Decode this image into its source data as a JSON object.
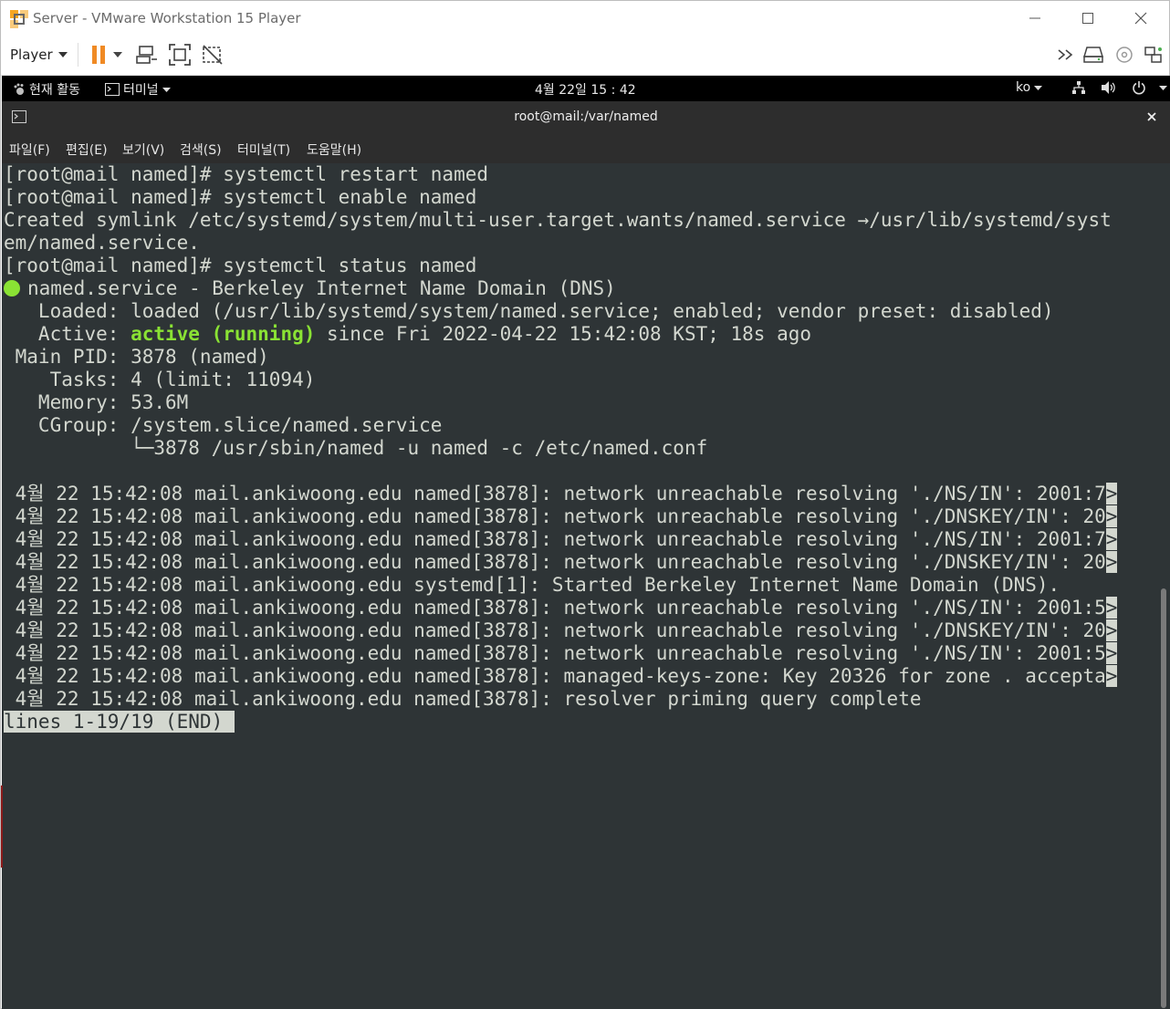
{
  "window": {
    "title": "Server - VMware Workstation 15 Player"
  },
  "toolbar": {
    "player_label": "Player"
  },
  "gnome": {
    "activities": "현재 활동",
    "app_menu": "터미널",
    "clock": "4월 22일  15 : 42",
    "lang": "ko"
  },
  "terminal": {
    "title": "root@mail:/var/named",
    "menu": [
      "파일(F)",
      "편집(E)",
      "보기(V)",
      "검색(S)",
      "터미널(T)",
      "도움말(H)"
    ],
    "lines": [
      "[root@mail named]# systemctl restart named",
      "[root@mail named]# systemctl enable named",
      "Created symlink /etc/systemd/system/multi-user.target.wants/named.service →/usr/lib/systemd/syst",
      "em/named.service.",
      "[root@mail named]# systemctl status named"
    ],
    "status": {
      "unit": "named.service - Berkeley Internet Name Domain (DNS)",
      "loaded": "   Loaded: loaded (/usr/lib/systemd/system/named.service; enabled; vendor preset: disabled)",
      "active_prefix": "   Active: ",
      "active_state": "active (running)",
      "active_suffix": " since Fri 2022-04-22 15:42:08 KST; 18s ago",
      "main_pid": " Main PID: 3878 (named)",
      "tasks": "    Tasks: 4 (limit: 11094)",
      "memory": "   Memory: 53.6M",
      "cgroup": "   CGroup: /system.slice/named.service",
      "cgroup_child": "           └─3878 /usr/sbin/named -u named -c /etc/named.conf"
    },
    "log": [
      {
        "text": " 4월 22 15:42:08 mail.ankiwoong.edu named[3878]: network unreachable resolving './NS/IN': 2001:7",
        "truncated": true
      },
      {
        "text": " 4월 22 15:42:08 mail.ankiwoong.edu named[3878]: network unreachable resolving './DNSKEY/IN': 20",
        "truncated": true
      },
      {
        "text": " 4월 22 15:42:08 mail.ankiwoong.edu named[3878]: network unreachable resolving './NS/IN': 2001:7",
        "truncated": true
      },
      {
        "text": " 4월 22 15:42:08 mail.ankiwoong.edu named[3878]: network unreachable resolving './DNSKEY/IN': 20",
        "truncated": true
      },
      {
        "text": " 4월 22 15:42:08 mail.ankiwoong.edu systemd[1]: Started Berkeley Internet Name Domain (DNS).",
        "truncated": false
      },
      {
        "text": " 4월 22 15:42:08 mail.ankiwoong.edu named[3878]: network unreachable resolving './NS/IN': 2001:5",
        "truncated": true
      },
      {
        "text": " 4월 22 15:42:08 mail.ankiwoong.edu named[3878]: network unreachable resolving './DNSKEY/IN': 20",
        "truncated": true
      },
      {
        "text": " 4월 22 15:42:08 mail.ankiwoong.edu named[3878]: network unreachable resolving './NS/IN': 2001:5",
        "truncated": true
      },
      {
        "text": " 4월 22 15:42:08 mail.ankiwoong.edu named[3878]: managed-keys-zone: Key 20326 for zone . accepta",
        "truncated": true
      },
      {
        "text": " 4월 22 15:42:08 mail.ankiwoong.edu named[3878]: resolver priming query complete",
        "truncated": false
      }
    ],
    "truncation_marker": ">",
    "pager_status": "lines 1-19/19 (END) "
  },
  "colors": {
    "terminal_bg": "#2e3436",
    "terminal_fg": "#d3d7cf",
    "active_green": "#8ae234",
    "pause_orange": "#f08a24"
  }
}
